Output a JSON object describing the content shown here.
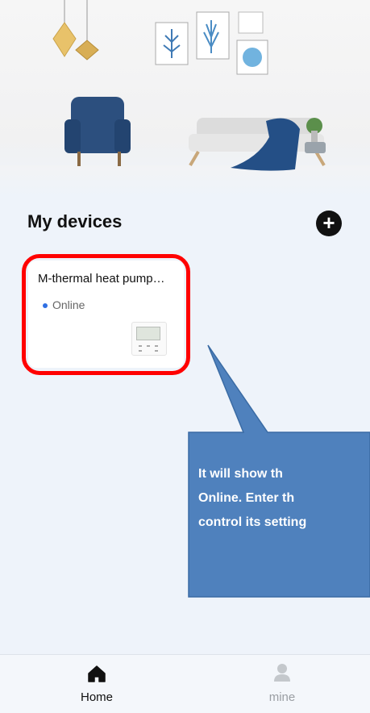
{
  "devices_section": {
    "title": "My devices",
    "add_icon": "plus-circle-icon"
  },
  "devices": [
    {
      "name": "M-thermal heat pump…",
      "status": "Online",
      "status_color": "#2f6fe3",
      "thumbnail": "wired-controller"
    }
  ],
  "annotation": {
    "highlight_color": "#ff0000",
    "callout_color": "#4f81bd",
    "lines": [
      "It will show th",
      "Online. Enter th",
      "control its setting"
    ]
  },
  "bottom_nav": {
    "items": [
      {
        "label": "Home",
        "icon": "home-icon",
        "active": true
      },
      {
        "label": "mine",
        "icon": "person-icon",
        "active": false
      }
    ]
  }
}
